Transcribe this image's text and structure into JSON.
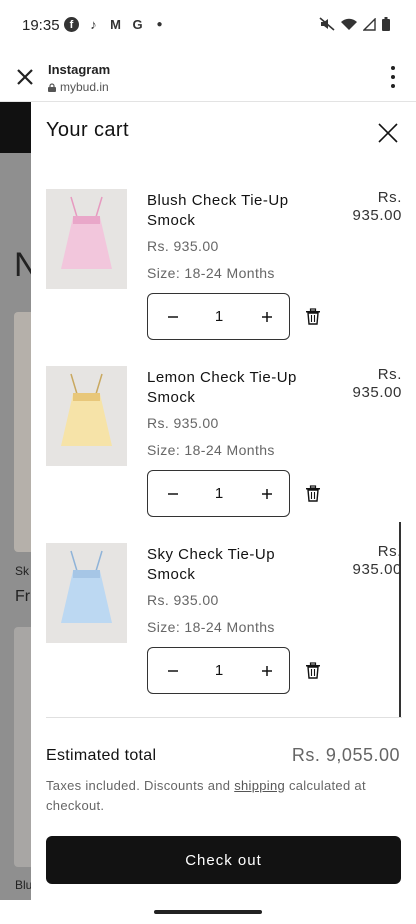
{
  "status_bar": {
    "time": "19:35",
    "left_icons": [
      "facebook-icon",
      "tiktok-icon",
      "gmail-icon",
      "google-icon",
      "dot-icon"
    ],
    "right_icons": [
      "mute-icon",
      "wifi-icon",
      "signal-icon",
      "battery-icon"
    ]
  },
  "browser": {
    "title": "Instagram",
    "url": "mybud.in"
  },
  "background_page": {
    "heading_partial": "N",
    "text1_partial": "Sk",
    "text2_partial": "Fr",
    "text3_partial": "Blu"
  },
  "cart": {
    "title": "Your cart",
    "items": [
      {
        "name": "Blush Check Tie-Up Smock",
        "price_right_line1": "Rs.",
        "price_right_line2": "935.00",
        "price": "Rs. 935.00",
        "size": "Size: 18-24 Months",
        "quantity": "1",
        "image_color": "#f2c6dc"
      },
      {
        "name": "Lemon Check Tie-Up Smock",
        "price_right_line1": "Rs.",
        "price_right_line2": "935.00",
        "price": "Rs. 935.00",
        "size": "Size: 18-24 Months",
        "quantity": "1",
        "image_color": "#f6e3a8"
      },
      {
        "name": "Sky Check Tie-Up Smock",
        "price_right_line1": "Rs.",
        "price_right_line2": "935.00",
        "price": "Rs. 935.00",
        "size": "Size: 18-24 Months",
        "quantity": "1",
        "image_color": "#bcd8f2"
      }
    ],
    "estimated_total_label": "Estimated total",
    "estimated_total_value": "Rs. 9,055.00",
    "tax_note_before": "Taxes included. Discounts and ",
    "tax_note_link": "shipping",
    "tax_note_after": " calculated at checkout.",
    "checkout_label": "Check out"
  }
}
